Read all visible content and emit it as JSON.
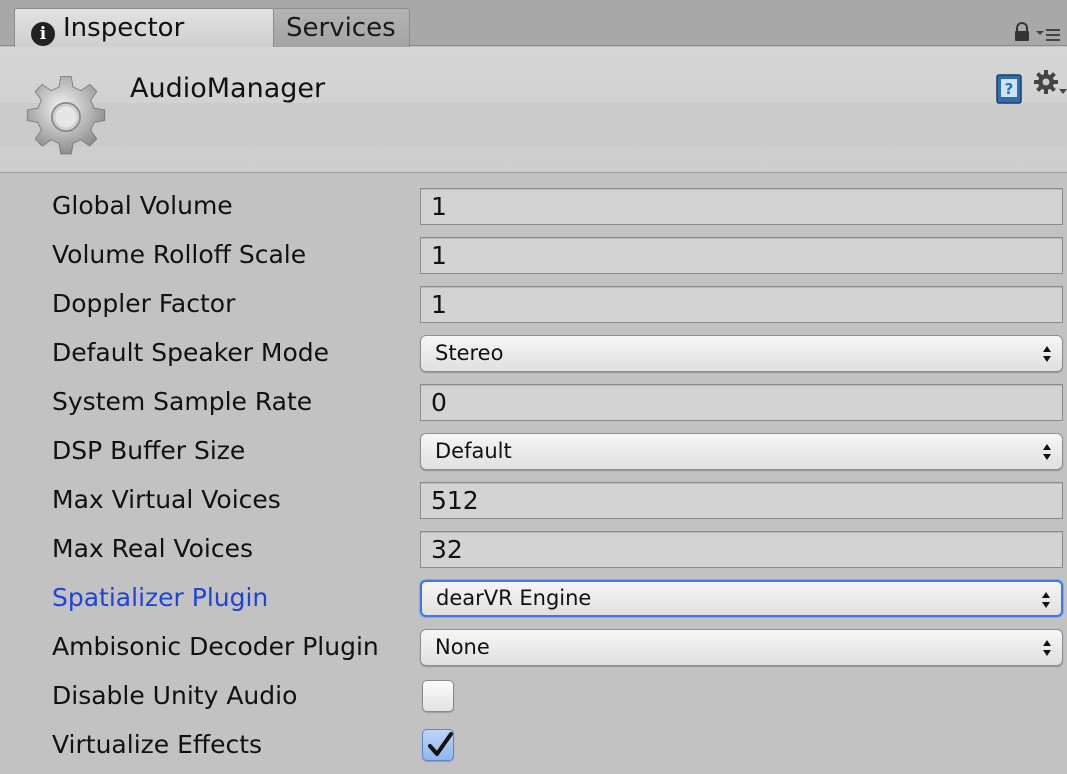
{
  "tabs": {
    "inspector": {
      "icon": "info-icon",
      "label": "Inspector"
    },
    "services": {
      "label": "Services"
    }
  },
  "tab_controls": {
    "lock": "lock-icon",
    "menu": "tab-menu-icon"
  },
  "header": {
    "icon": "gear-icon",
    "title": "AudioManager",
    "help": "help-book-icon",
    "settings": "settings-gear-icon"
  },
  "properties": [
    {
      "label": "Global Volume",
      "type": "number",
      "value": "1"
    },
    {
      "label": "Volume Rolloff Scale",
      "type": "number",
      "value": "1"
    },
    {
      "label": "Doppler Factor",
      "type": "number",
      "value": "1"
    },
    {
      "label": "Default Speaker Mode",
      "type": "dropdown",
      "value": "Stereo"
    },
    {
      "label": "System Sample Rate",
      "type": "number",
      "value": "0"
    },
    {
      "label": "DSP Buffer Size",
      "type": "dropdown",
      "value": "Default"
    },
    {
      "label": "Max Virtual Voices",
      "type": "number",
      "value": "512"
    },
    {
      "label": "Max Real Voices",
      "type": "number",
      "value": "32"
    },
    {
      "label": "Spatializer Plugin",
      "type": "dropdown",
      "value": "dearVR Engine",
      "focused": true,
      "label_color": "#1f44d6"
    },
    {
      "label": "Ambisonic Decoder Plugin",
      "type": "dropdown",
      "value": "None"
    },
    {
      "label": "Disable Unity Audio",
      "type": "checkbox",
      "checked": false
    },
    {
      "label": "Virtualize Effects",
      "type": "checkbox",
      "checked": true
    }
  ],
  "colors": {
    "background": "#c2c2c2",
    "focus_accent": "#3c78e8",
    "highlight_label": "#1f44d6"
  }
}
